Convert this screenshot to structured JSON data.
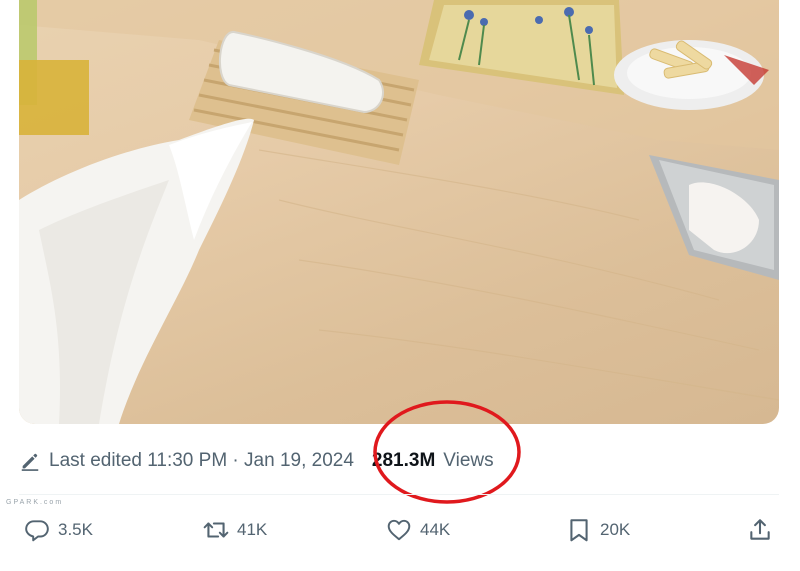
{
  "post": {
    "edited_text": "Last edited 11:30 PM · Jan 19, 2024",
    "views_count": "281.3M",
    "views_label": "Views"
  },
  "actions": {
    "reply_count": "3.5K",
    "repost_count": "41K",
    "like_count": "44K",
    "bookmark_count": "20K"
  },
  "icons": {
    "edit": "pencil-icon",
    "reply": "reply-icon",
    "repost": "repost-icon",
    "like": "heart-icon",
    "bookmark": "bookmark-icon",
    "share": "share-icon"
  },
  "colors": {
    "text_secondary": "#536471",
    "text_primary": "#0f1419",
    "annotation_red": "#e0191d"
  },
  "watermark": {
    "text": "GPARK.com"
  }
}
